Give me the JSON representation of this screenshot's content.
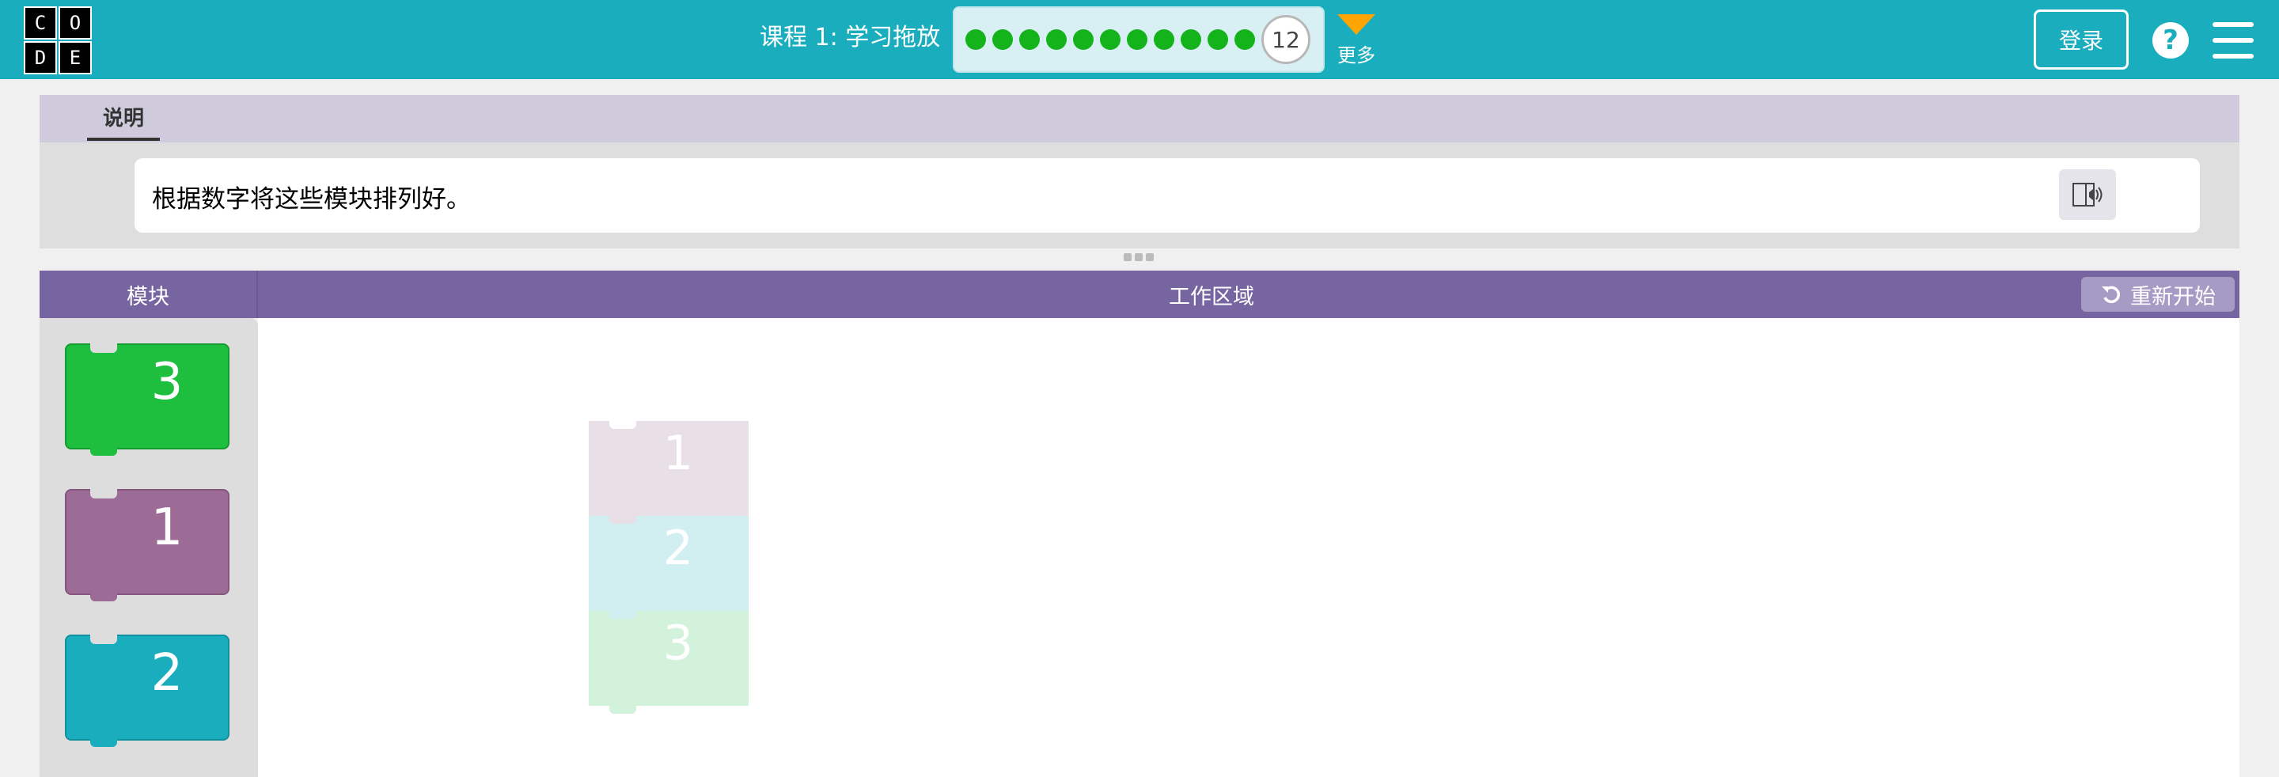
{
  "header": {
    "logo_letters": [
      "C",
      "O",
      "D",
      "E"
    ],
    "lesson_title": "课程 1: 学习拖放",
    "progress_dots_completed": 11,
    "current_level": "12",
    "more_label": "更多",
    "sign_in_label": "登录",
    "help_glyph": "?",
    "colors": {
      "bar": "#1aadbd",
      "dot": "#14b21b",
      "more_arrow": "#ffa400"
    }
  },
  "instructions": {
    "tab_label": "说明",
    "text": "根据数字将这些模块排列好。",
    "tts_icon": "text-to-speech-icon"
  },
  "workspace_header": {
    "toolbox_title": "模块",
    "workspace_title": "工作区域",
    "restart_label": "重新开始",
    "restart_icon": "undo-icon"
  },
  "toolbox_blocks": [
    {
      "label": "3",
      "color": "#1ebe3f"
    },
    {
      "label": "1",
      "color": "#9c6b96"
    },
    {
      "label": "2",
      "color": "#1aadbd"
    }
  ],
  "ghost_blocks": [
    {
      "label": "1",
      "color": "#e8dfe7"
    },
    {
      "label": "2",
      "color": "#d1eef1"
    },
    {
      "label": "3",
      "color": "#d2f2dc"
    }
  ]
}
